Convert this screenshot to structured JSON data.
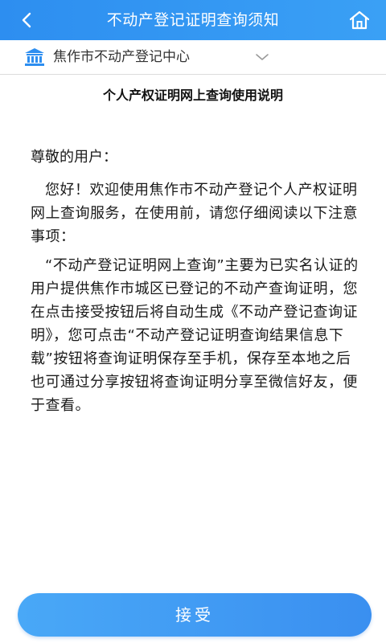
{
  "header": {
    "title": "不动产登记证明查询须知",
    "back_icon": "chevron-left-icon",
    "home_icon": "home-icon",
    "bg_color": "#2d8ef0"
  },
  "org_selector": {
    "name": "焦作市不动产登记中心",
    "icon": "institution-building-icon",
    "chevron": "chevron-down-icon",
    "icon_color": "#2d8ef0"
  },
  "document": {
    "title": "个人产权证明网上查询使用说明",
    "greeting": "尊敬的用户：",
    "paragraph_1": "您好！欢迎使用焦作市不动产登记个人产权证明网上查询服务，在使用前，请您仔细阅读以下注意事项：",
    "paragraph_2": "“不动产登记证明网上查询”主要为已实名认证的用户提供焦作市城区已登记的不动产查询证明，您在点击接受按钮后将自动生成《不动产登记查询证明》，您可点击“不动产登记证明查询结果信息下载”按钮将查询证明保存至手机，保存至本地之后也可通过分享按钮将查询证明分享至微信好友，便于查看。"
  },
  "footer": {
    "accept_label": "接受",
    "accent_color": "#3a8ff0"
  }
}
